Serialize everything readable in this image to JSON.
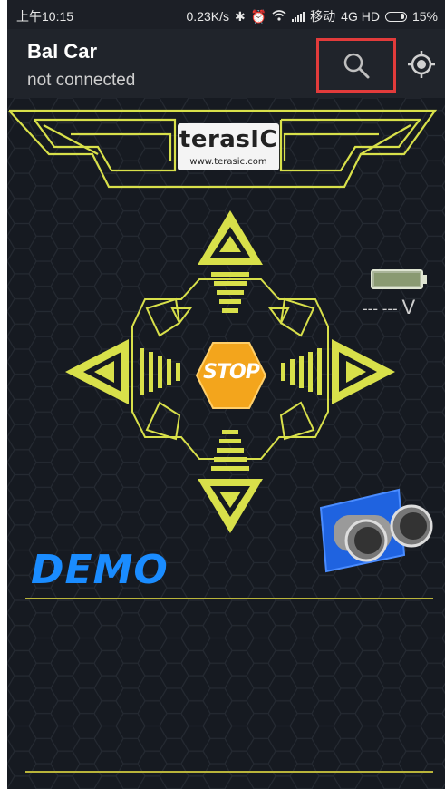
{
  "status_bar": {
    "time": "上午10:15",
    "network_speed": "0.23K/s",
    "carrier": "移动",
    "network_type": "4G HD",
    "battery_percent": "15%"
  },
  "action_bar": {
    "title": "Bal Car",
    "subtitle": "not connected",
    "search_icon": "search-icon",
    "locate_icon": "gps-locate-icon"
  },
  "logo": {
    "brand": "terasIC",
    "url": "www.terasic.com"
  },
  "controls": {
    "stop_label": "STOP",
    "up_icon": "arrow-up-icon",
    "down_icon": "arrow-down-icon",
    "left_icon": "arrow-left-icon",
    "right_icon": "arrow-right-icon"
  },
  "battery_voltage": {
    "value": "--- ---",
    "unit": "V"
  },
  "demo_label": "DEMO",
  "colors": {
    "accent_yellow": "#d8e04a",
    "stop_orange": "#f3a51c",
    "demo_blue": "#1a8cff",
    "highlight_red": "#e23b3b"
  }
}
